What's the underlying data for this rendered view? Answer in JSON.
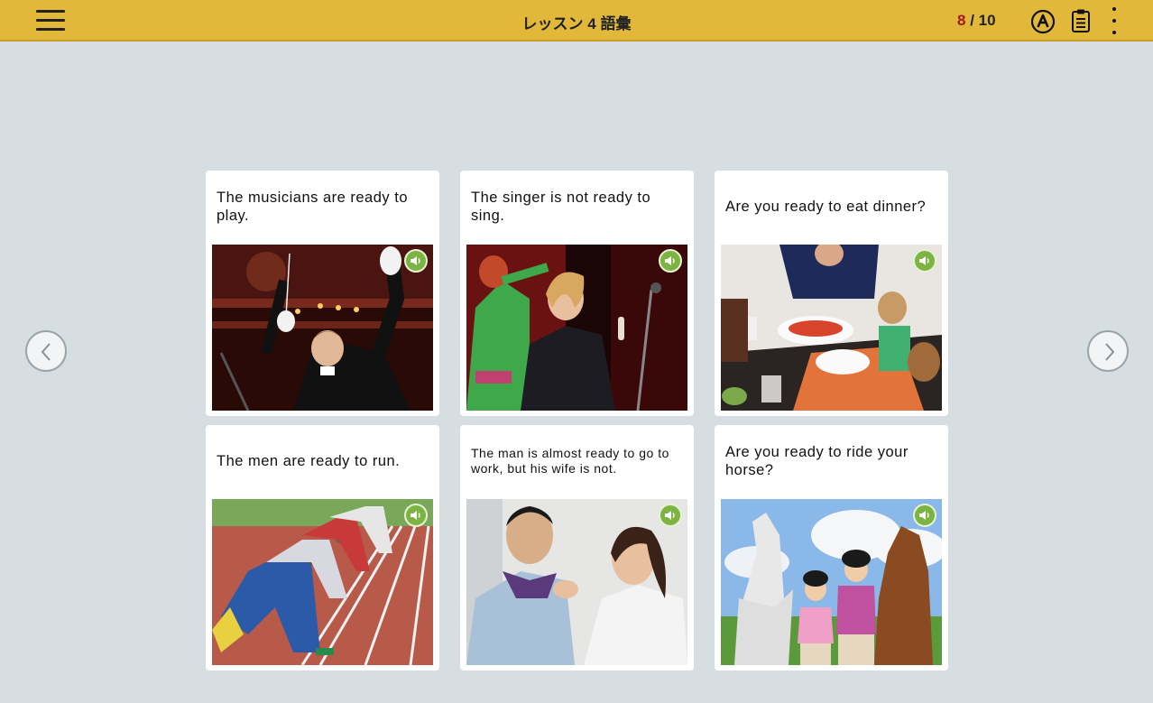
{
  "header": {
    "title": "レッスン 4 語彙",
    "progress_current": "8",
    "progress_separator": " / ",
    "progress_total": "10"
  },
  "colors": {
    "topbar": "#e2b83b",
    "background": "#d6dee2",
    "progress_current": "#a4161a",
    "speaker": "#7cb342"
  },
  "icons": {
    "menu": "hamburger-icon",
    "a_circle": "a-circle-icon",
    "clipboard": "clipboard-icon",
    "more": "more-vertical-icon",
    "prev": "chevron-left-icon",
    "next": "chevron-right-icon",
    "audio": "speaker-icon"
  },
  "cards": [
    {
      "caption": "The musicians are ready to play.",
      "image": "conductor-photo"
    },
    {
      "caption": "The singer is not ready to sing.",
      "image": "singer-photo"
    },
    {
      "caption": "Are you ready to eat dinner?",
      "image": "dinner-photo"
    },
    {
      "caption": "The men are ready to run.",
      "image": "runners-photo"
    },
    {
      "caption": "The man is almost ready to go to work, but his wife is not.",
      "image": "necktie-photo"
    },
    {
      "caption": "Are you ready to ride your horse?",
      "image": "horse-photo"
    }
  ]
}
